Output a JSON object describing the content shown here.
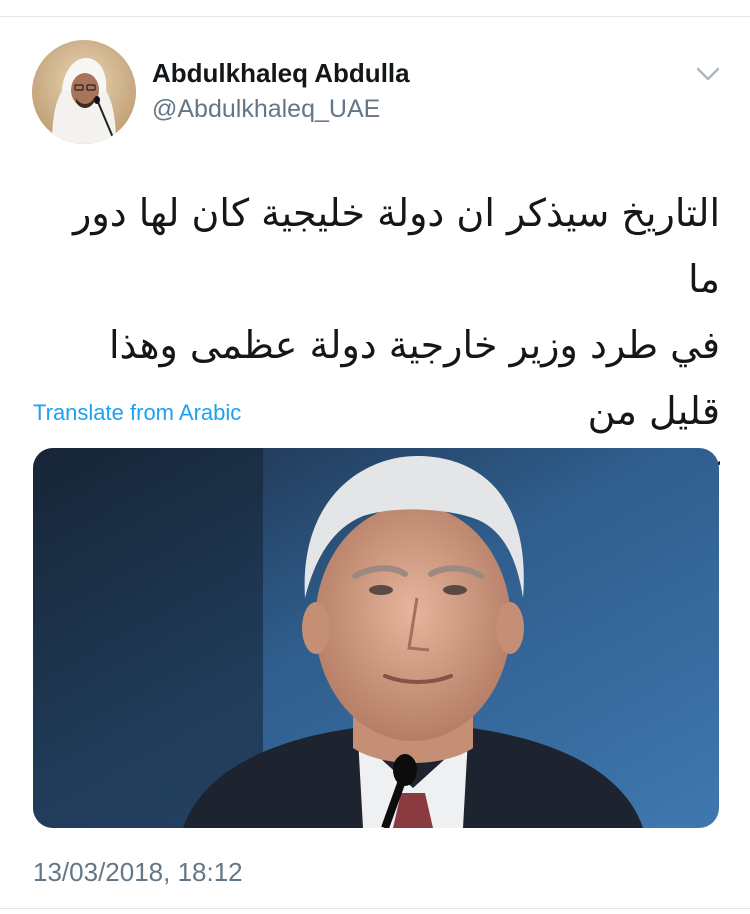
{
  "tweet": {
    "author": {
      "display_name": "Abdulkhaleq Abdulla",
      "handle": "@Abdulkhaleq_UAE",
      "avatar_icon": "profile-photo"
    },
    "menu_icon": "chevron-down-icon",
    "text": "التاريخ سيذكر ان دولة خليجية كان لها دور ما\nفي طرد وزير خارجية دولة عظمى وهذا قليل من\nكثير.",
    "translate_label": "Translate from Arabic",
    "media_icon": "photo",
    "timestamp": "13/03/2018, 18:12"
  },
  "colors": {
    "text_primary": "#14171a",
    "text_secondary": "#657786",
    "link": "#1da1f2",
    "divider": "#e1e8ed"
  }
}
